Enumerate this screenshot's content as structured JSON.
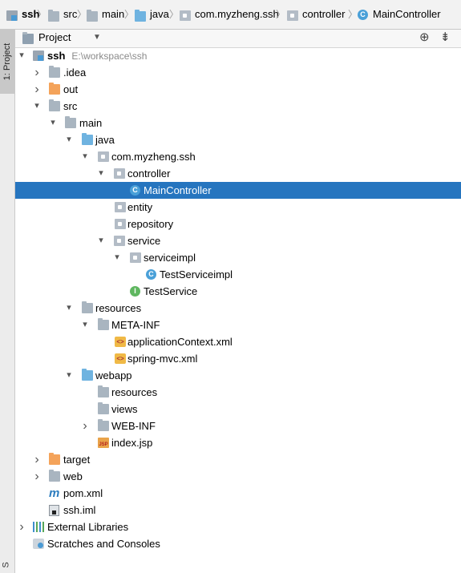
{
  "breadcrumb": {
    "items": [
      {
        "label": "ssh",
        "icon": "module-folder-icon",
        "bold": true
      },
      {
        "label": "src",
        "icon": "folder-icon"
      },
      {
        "label": "main",
        "icon": "folder-icon"
      },
      {
        "label": "java",
        "icon": "source-folder-icon"
      },
      {
        "label": "com.myzheng.ssh",
        "icon": "package-icon"
      },
      {
        "label": "controller",
        "icon": "package-icon"
      },
      {
        "label": "MainController",
        "icon": "class-icon"
      }
    ],
    "separator": "〉"
  },
  "side_strip": {
    "tab_label": "1: Project",
    "bottom_letter": "S"
  },
  "panel": {
    "title": "Project",
    "dropdown_icon": "▼",
    "locate_icon": "⊕",
    "collapse_icon": "⇟"
  },
  "tree": {
    "rows": [
      {
        "label": "ssh",
        "hint": "E:\\workspace\\ssh",
        "arrow": "▾",
        "icon": "module-folder-icon",
        "bold": true
      },
      {
        "label": ".idea",
        "arrow": "›",
        "icon": "folder-icon"
      },
      {
        "label": "out",
        "arrow": "›",
        "icon": "orange-folder-icon"
      },
      {
        "label": "src",
        "arrow": "▾",
        "icon": "folder-icon"
      },
      {
        "label": "main",
        "arrow": "▾",
        "icon": "folder-icon"
      },
      {
        "label": "java",
        "arrow": "▾",
        "icon": "source-folder-icon"
      },
      {
        "label": "com.myzheng.ssh",
        "arrow": "▾",
        "icon": "package-icon"
      },
      {
        "label": "controller",
        "arrow": "▾",
        "icon": "package-icon"
      },
      {
        "label": "MainController",
        "icon": "class-icon",
        "selected": true
      },
      {
        "label": "entity",
        "icon": "package-icon"
      },
      {
        "label": "repository",
        "icon": "package-icon"
      },
      {
        "label": "service",
        "arrow": "▾",
        "icon": "package-icon"
      },
      {
        "label": "serviceimpl",
        "arrow": "▾",
        "icon": "package-icon"
      },
      {
        "label": "TestServiceimpl",
        "icon": "class-icon"
      },
      {
        "label": "TestService",
        "icon": "interface-icon"
      },
      {
        "label": "resources",
        "arrow": "▾",
        "icon": "folder-icon"
      },
      {
        "label": "META-INF",
        "arrow": "▾",
        "icon": "folder-icon"
      },
      {
        "label": "applicationContext.xml",
        "icon": "xml-file-icon"
      },
      {
        "label": "spring-mvc.xml",
        "icon": "xml-file-icon"
      },
      {
        "label": "webapp",
        "arrow": "▾",
        "icon": "web-folder-icon"
      },
      {
        "label": "resources",
        "icon": "folder-icon"
      },
      {
        "label": "views",
        "icon": "folder-icon"
      },
      {
        "label": "WEB-INF",
        "arrow": "›",
        "icon": "folder-icon"
      },
      {
        "label": "index.jsp",
        "icon": "jsp-file-icon"
      },
      {
        "label": "target",
        "arrow": "›",
        "icon": "orange-folder-icon"
      },
      {
        "label": "web",
        "arrow": "›",
        "icon": "folder-icon"
      },
      {
        "label": "pom.xml",
        "icon": "maven-icon"
      },
      {
        "label": "ssh.iml",
        "icon": "iml-file-icon"
      },
      {
        "label": "External Libraries",
        "arrow": "›",
        "icon": "libraries-icon"
      },
      {
        "label": "Scratches and Consoles",
        "icon": "scratches-icon"
      }
    ]
  },
  "colors": {
    "selection": "#2675bf",
    "folder": "#a9b5c0",
    "excluded_folder": "#f4a35a",
    "source_folder": "#6fb3e0"
  }
}
